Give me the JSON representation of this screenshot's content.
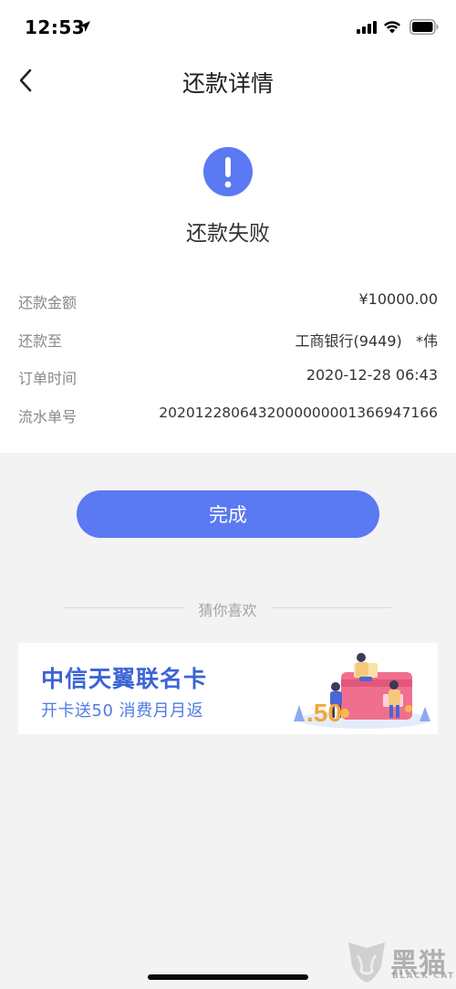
{
  "status_bar": {
    "time": "12:53",
    "icons": [
      "location-arrow-icon",
      "signal-icon",
      "wifi-icon",
      "battery-icon"
    ]
  },
  "nav": {
    "back_icon": "chevron-left-icon",
    "title": "还款详情"
  },
  "result": {
    "icon": "exclamation-circle-icon",
    "icon_color": "#5a79f2",
    "text": "还款失败"
  },
  "details": [
    {
      "label": "还款金额",
      "value": "¥10000.00"
    },
    {
      "label": "还款至",
      "value": "工商银行(9449)   *伟"
    },
    {
      "label": "订单时间",
      "value": "2020-12-28 06:43"
    },
    {
      "label": "流水单号",
      "value": "2020122806432000000001366947166"
    }
  ],
  "done_button": {
    "label": "完成",
    "color": "#5a79f2"
  },
  "recommend": {
    "label": "猜你喜欢"
  },
  "banner": {
    "title": "中信天翼联名卡",
    "subtitle": "开卡送50 消费月月返",
    "title_color": "#3b64d6",
    "art_text": ".50"
  },
  "watermark": {
    "text": "黑猫",
    "sub": "BLACK CAT"
  }
}
